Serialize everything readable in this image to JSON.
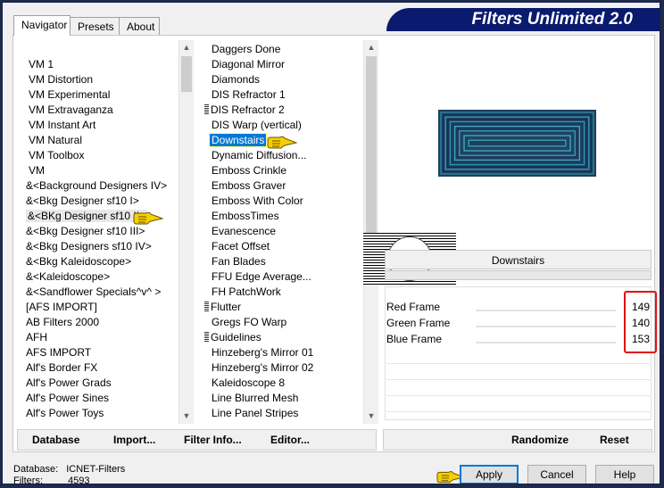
{
  "window": {
    "title": "Filters Unlimited 2.0"
  },
  "tabs": [
    {
      "label": "Navigator",
      "active": true
    },
    {
      "label": "Presets",
      "active": false
    },
    {
      "label": "About",
      "active": false
    }
  ],
  "categories": {
    "items": [
      "VM 1",
      "VM Distortion",
      "VM Experimental",
      "VM Extravaganza",
      "VM Instant Art",
      "VM Natural",
      "VM Toolbox",
      "VM",
      "&<Background Designers IV>",
      "&<Bkg Designer sf10 I>",
      "&<BKg Designer sf10 II>",
      "&<Bkg Designer sf10 III>",
      "&<Bkg Designers sf10 IV>",
      "&<Bkg Kaleidoscope>",
      "&<Kaleidoscope>",
      "&<Sandflower Specials^v^ >",
      "[AFS IMPORT]",
      "AB Filters 2000",
      "AFH",
      "AFS IMPORT",
      "Alf's Border FX",
      "Alf's Power Grads",
      "Alf's Power Sines",
      "Alf's Power Toys"
    ],
    "selected_index": 10
  },
  "filters": {
    "items": [
      "Daggers Done",
      "Diagonal Mirror",
      "Diamonds",
      "DIS Refractor 1",
      "DIS Refractor 2",
      "DIS Warp (vertical)",
      "Downstairs",
      "Dynamic Diffusion...",
      "Emboss Crinkle",
      "Emboss Graver",
      "Emboss With Color",
      "EmbossTimes",
      "Evanescence",
      "Facet Offset",
      "Fan Blades",
      "FFU Edge Average...",
      "FH PatchWork",
      "Flutter",
      "Gregs FO Warp",
      "Guidelines",
      "Hinzeberg's Mirror 01",
      "Hinzeberg's Mirror 02",
      "Kaleidoscope 8",
      "Line Blurred Mesh",
      "Line Panel Stripes"
    ],
    "grip_indices": [
      4,
      17,
      19
    ],
    "selected_index": 6
  },
  "left_toolbar": {
    "database": "Database",
    "import": "Import...",
    "filter_info": "Filter Info...",
    "editor": "Editor..."
  },
  "preview": {
    "watermark": "claudia",
    "frame_colors": [
      "#2b8ea6",
      "#1a2f5e",
      "#3a9cb5",
      "#152c58",
      "#2f97ae",
      "#1c3868",
      "#46a8b8",
      "#173a66",
      "#3aa2b2",
      "#1e4470",
      "#52b0bc",
      "#1b4a72",
      "#44a6b0"
    ]
  },
  "filter_name": "Downstairs",
  "params": [
    {
      "label": "Red Frame",
      "value": "149",
      "level": 149
    },
    {
      "label": "Green Frame",
      "value": "140",
      "level": 140
    },
    {
      "label": "Blue Frame",
      "value": "153",
      "level": 153
    }
  ],
  "right_toolbar": {
    "randomize": "Randomize",
    "reset": "Reset"
  },
  "status": {
    "database_label": "Database:",
    "database_value": "ICNET-Filters",
    "filters_label": "Filters:",
    "filters_value": "4593"
  },
  "buttons": {
    "apply": "Apply",
    "cancel": "Cancel",
    "help": "Help"
  },
  "colors": {
    "banner": "#0a1a6e",
    "selection": "#0078d7",
    "highlight_box": "#e01010",
    "pointer_hand": "#f5d000"
  }
}
